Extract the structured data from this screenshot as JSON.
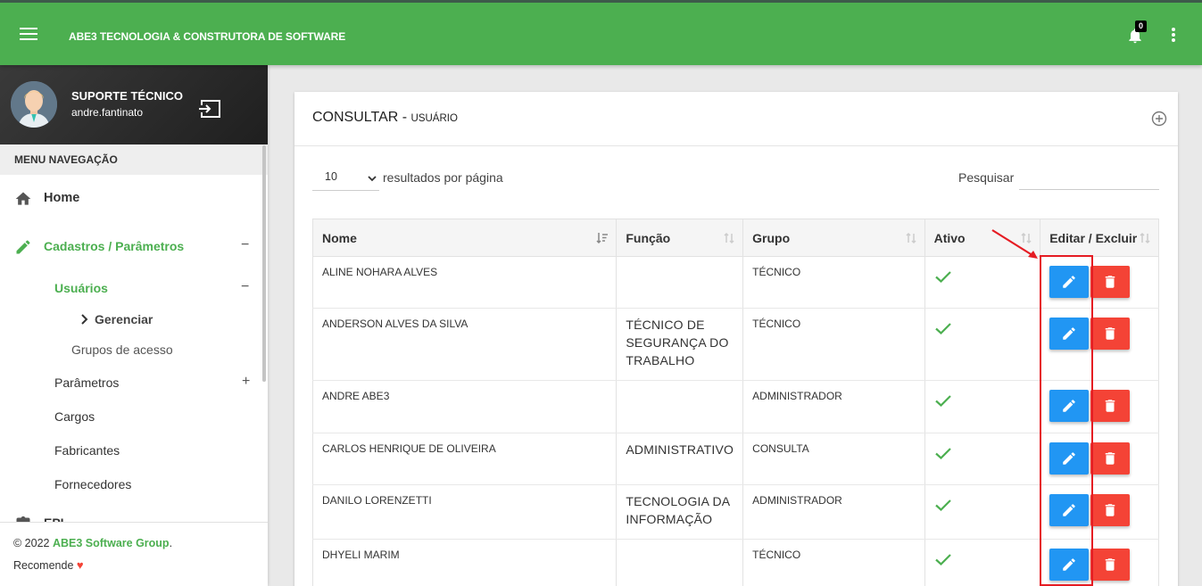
{
  "header": {
    "brand": "ABE3 TECNOLOGIA & CONSTRUTORA DE SOFTWARE",
    "notification_count": "0",
    "color": "#4caf50"
  },
  "user": {
    "name": "SUPORTE TÉCNICO",
    "login": "andre.fantinato"
  },
  "sidebar": {
    "menu_title": "MENU NAVEGAÇÃO",
    "home": "Home",
    "cadastros": "Cadastros / Parâmetros",
    "usuarios": "Usuários",
    "gerenciar": "Gerenciar",
    "grupos": "Grupos de acesso",
    "parametros": "Parâmetros",
    "cargos": "Cargos",
    "fabricantes": "Fabricantes",
    "fornecedores": "Fornecedores",
    "epi_partial": "EPI",
    "toggle_open": "−",
    "toggle_closed": "+"
  },
  "footer": {
    "copyright": "© 2022",
    "company": "ABE3 Software Group",
    "period": ".",
    "recommend": "Recomende"
  },
  "card": {
    "title": "CONSULTAR",
    "separator": " - ",
    "subtitle": "USUÁRIO",
    "page_length": "10",
    "length_label": "resultados por página",
    "search_label": "Pesquisar",
    "search_value": ""
  },
  "table": {
    "columns": [
      "Nome",
      "Função",
      "Grupo",
      "Ativo",
      "Editar / Excluir"
    ],
    "rows": [
      {
        "nome": "ALINE NOHARA ALVES",
        "funcao": "",
        "grupo": "TÉCNICO"
      },
      {
        "nome": "ANDERSON ALVES DA SILVA",
        "funcao": "TÉCNICO DE SEGURANÇA DO TRABALHO",
        "grupo": "TÉCNICO"
      },
      {
        "nome": "ANDRE ABE3",
        "funcao": "",
        "grupo": "ADMINISTRADOR"
      },
      {
        "nome": "CARLOS HENRIQUE DE OLIVEIRA",
        "funcao": "ADMINISTRATIVO",
        "grupo": "CONSULTA"
      },
      {
        "nome": "DANILO LORENZETTI",
        "funcao": "TECNOLOGIA DA INFORMAÇÃO",
        "grupo": "ADMINISTRADOR"
      },
      {
        "nome": "DHYELI MARIM",
        "funcao": "",
        "grupo": "TÉCNICO"
      }
    ]
  }
}
